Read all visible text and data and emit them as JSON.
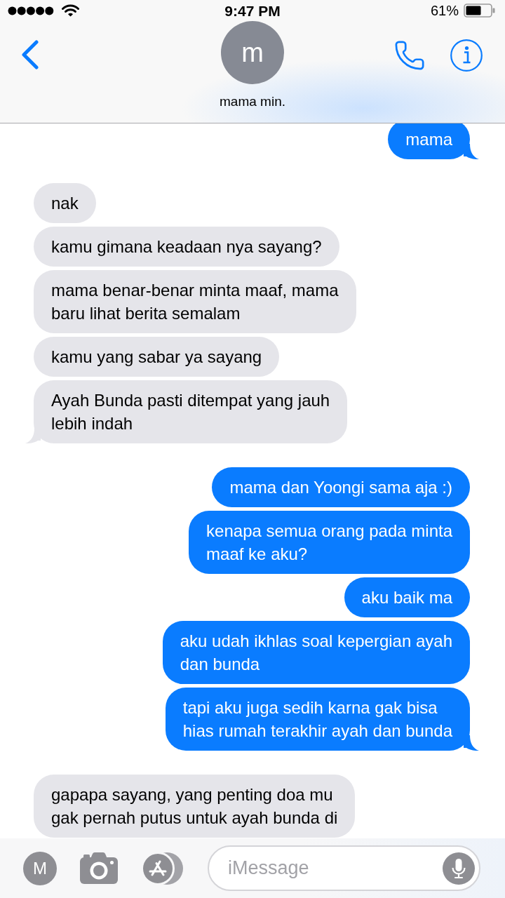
{
  "status_bar": {
    "time": "9:47 PM",
    "battery_text": "61%"
  },
  "header": {
    "avatar_initial": "m",
    "contact_name": "mama min."
  },
  "messages": [
    {
      "kind": "sent",
      "text": "mama",
      "tail": true
    },
    {
      "kind": "received",
      "text": "nak",
      "tail": false
    },
    {
      "kind": "received",
      "text": "kamu gimana keadaan nya sayang?",
      "tail": false
    },
    {
      "kind": "received",
      "text": "mama benar-benar minta maaf, mama\nbaru lihat berita semalam",
      "tail": false
    },
    {
      "kind": "received",
      "text": "kamu yang sabar ya sayang",
      "tail": false
    },
    {
      "kind": "received",
      "text": "Ayah Bunda pasti ditempat yang jauh\nlebih indah",
      "tail": true
    },
    {
      "kind": "sent",
      "text": "mama dan Yoongi sama aja :)",
      "tail": false
    },
    {
      "kind": "sent",
      "text": "kenapa semua orang pada minta\nmaaf ke aku?",
      "tail": false
    },
    {
      "kind": "sent",
      "text": "aku baik ma",
      "tail": false
    },
    {
      "kind": "sent",
      "text": "aku udah ikhlas soal kepergian ayah\ndan bunda",
      "tail": false
    },
    {
      "kind": "sent",
      "text": "tapi aku juga sedih karna gak bisa\nhias rumah terakhir ayah dan bunda",
      "tail": true
    },
    {
      "kind": "received",
      "text": "gapapa sayang, yang penting doa mu\ngak pernah putus untuk ayah bunda di",
      "tail": false
    }
  ],
  "composer": {
    "apps_initial": "M",
    "placeholder": "iMessage"
  }
}
